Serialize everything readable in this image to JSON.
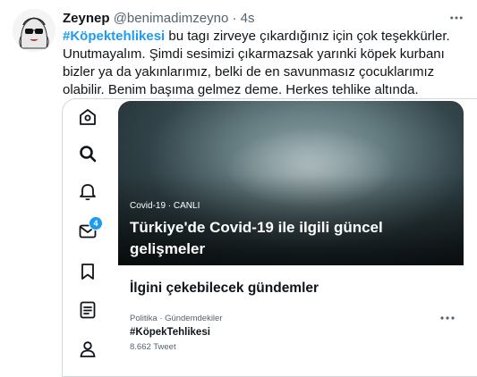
{
  "tweet": {
    "author_name": "Zeynep",
    "handle": "@benimadimzeyno",
    "separator": "·",
    "time": "4s",
    "hashtag": "#Köpektehlikesi",
    "text": " bu tagı zirveye çıkardığınız için çok teşekkürler. Unutmayalım. Şimdi sesimizi çıkarmazsak yarınki köpek kurbanı bizler ya da yakınlarımız, belki de en savunmasız çocuklarımız olabilir. Benim başıma gelmez deme. Herkes tehlike altında."
  },
  "media": {
    "sidebar_icons": [
      "home-icon",
      "search-icon",
      "notifications-icon",
      "messages-icon",
      "bookmarks-icon",
      "lists-icon",
      "profile-icon"
    ],
    "messages_badge": "4",
    "hero_label": "Covid-19 · CANLI",
    "hero_title": "Türkiye'de Covid-19 ile ilgili güncel gelişmeler",
    "trends_title": "İlgini çekebilecek gündemler",
    "trend": {
      "meta": "Politika · Gündemdekiler",
      "tag": "#KöpekTehlikesi",
      "count": "8.662 Tweet"
    }
  },
  "colors": {
    "accent": "#1d9bf0",
    "text": "#0f1419",
    "secondary": "#536471",
    "border": "#cfd9de"
  }
}
